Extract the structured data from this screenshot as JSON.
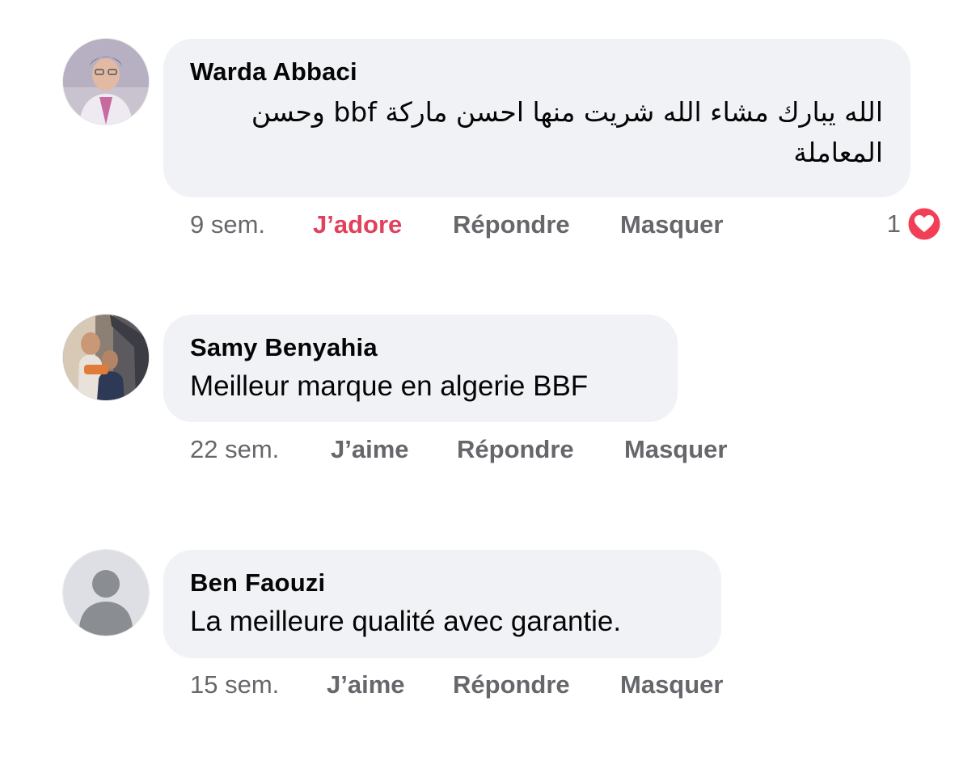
{
  "comments": [
    {
      "author": "Warda Abbaci",
      "text": "الله يبارك مشاء الله شريت منها احسن ماركة bbf وحسن المعاملة",
      "time": "9 sem.",
      "like_label": "J’adore",
      "reply_label": "Répondre",
      "hide_label": "Masquer",
      "reaction_count": "1",
      "reaction_icon": "heart-icon",
      "avatar": "profile-photo"
    },
    {
      "author": "Samy Benyahia",
      "text": "Meilleur marque en algerie BBF",
      "time": "22 sem.",
      "like_label": "J’aime",
      "reply_label": "Répondre",
      "hide_label": "Masquer",
      "avatar": "profile-photo"
    },
    {
      "author": "Ben Faouzi",
      "text": "La meilleure qualité avec garantie.",
      "time": "15 sem.",
      "like_label": "J’aime",
      "reply_label": "Répondre",
      "hide_label": "Masquer",
      "avatar": "default-avatar-icon"
    }
  ],
  "colors": {
    "bubble_bg": "#f0f2f5",
    "text": "#050505",
    "meta": "#65676b",
    "love": "#e0415d",
    "heart_badge": "#f33e58"
  }
}
